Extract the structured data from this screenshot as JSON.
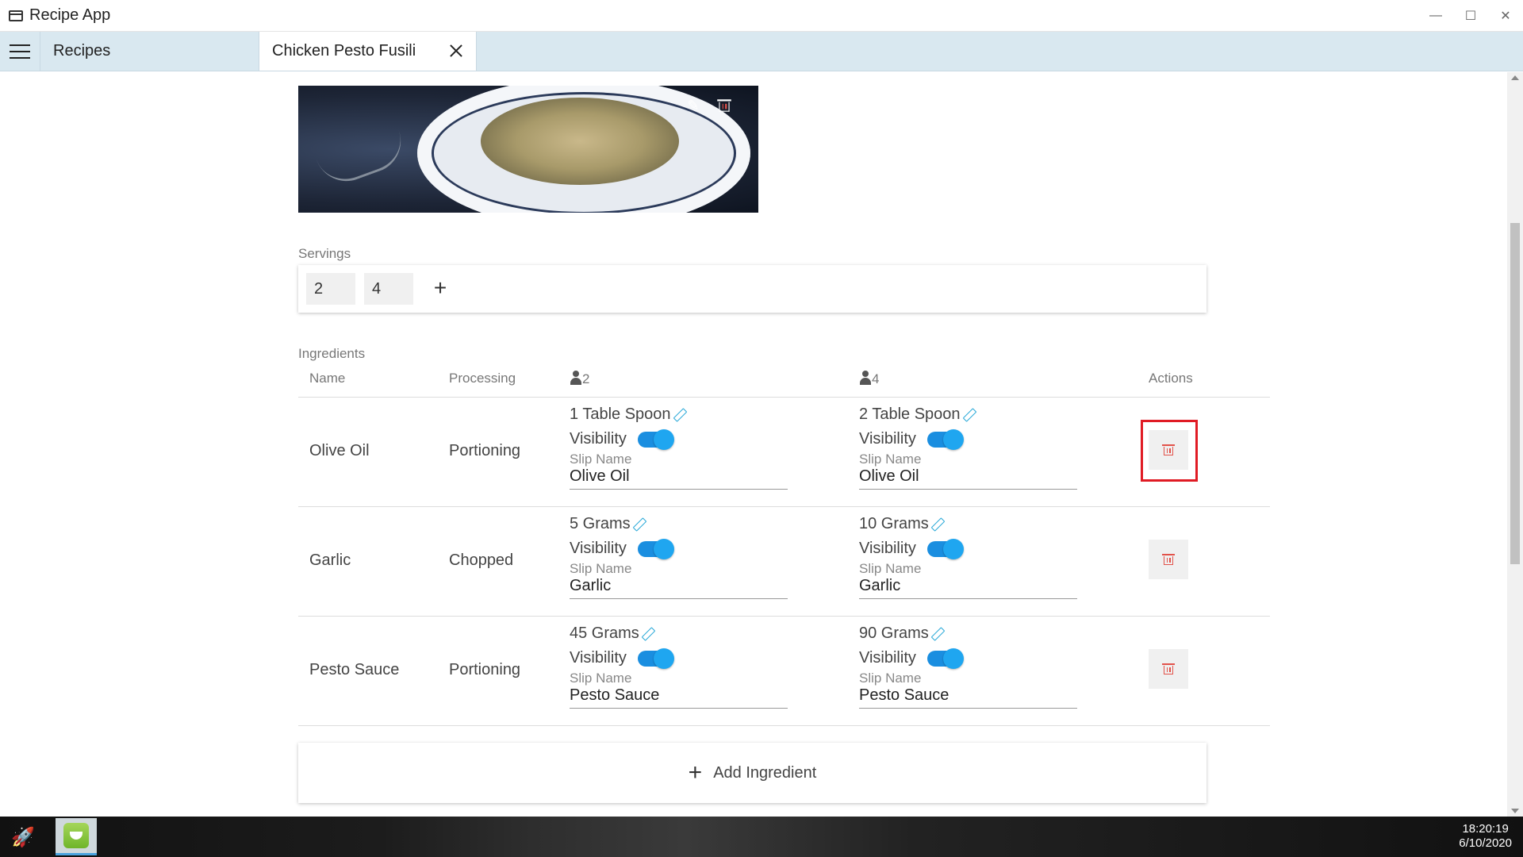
{
  "window": {
    "title": "Recipe App"
  },
  "tabs": {
    "recipes_label": "Recipes",
    "active_label": "Chicken Pesto Fusili"
  },
  "servings": {
    "label": "Servings",
    "values": [
      "2",
      "4"
    ],
    "add_symbol": "+"
  },
  "ingredients": {
    "label": "Ingredients",
    "headers": {
      "name": "Name",
      "processing": "Processing",
      "serving_a": "2",
      "serving_b": "4",
      "actions": "Actions"
    },
    "visibility_label": "Visibility",
    "slip_name_label": "Slip Name",
    "rows": [
      {
        "name": "Olive Oil",
        "processing": "Portioning",
        "qty_a": "1 Table Spoon",
        "qty_b": "2 Table Spoon",
        "slip_a": "Olive Oil",
        "slip_b": "Olive Oil",
        "visible_a": true,
        "visible_b": true
      },
      {
        "name": "Garlic",
        "processing": "Chopped",
        "qty_a": "5 Grams",
        "qty_b": "10 Grams",
        "slip_a": "Garlic",
        "slip_b": "Garlic",
        "visible_a": true,
        "visible_b": true
      },
      {
        "name": "Pesto Sauce",
        "processing": "Portioning",
        "qty_a": "45 Grams",
        "qty_b": "90 Grams",
        "slip_a": "Pesto Sauce",
        "slip_b": "Pesto Sauce",
        "visible_a": true,
        "visible_b": true
      }
    ]
  },
  "add_ingredient": {
    "label": "Add Ingredient",
    "symbol": "+"
  },
  "taskbar": {
    "time": "18:20:19",
    "date": "6/10/2020"
  },
  "colors": {
    "accent": "#29a9d8",
    "toggle_on": "#1fa6f0",
    "delete": "#e2524a",
    "highlight": "#e01b24",
    "tabbar": "#d9e8f0"
  },
  "icons": [
    "app-window-icon",
    "hamburger-icon",
    "close-icon",
    "edit-icon",
    "trash-icon",
    "person-icon",
    "pencil-icon",
    "plus-icon",
    "gear-icon",
    "rocket-icon"
  ]
}
